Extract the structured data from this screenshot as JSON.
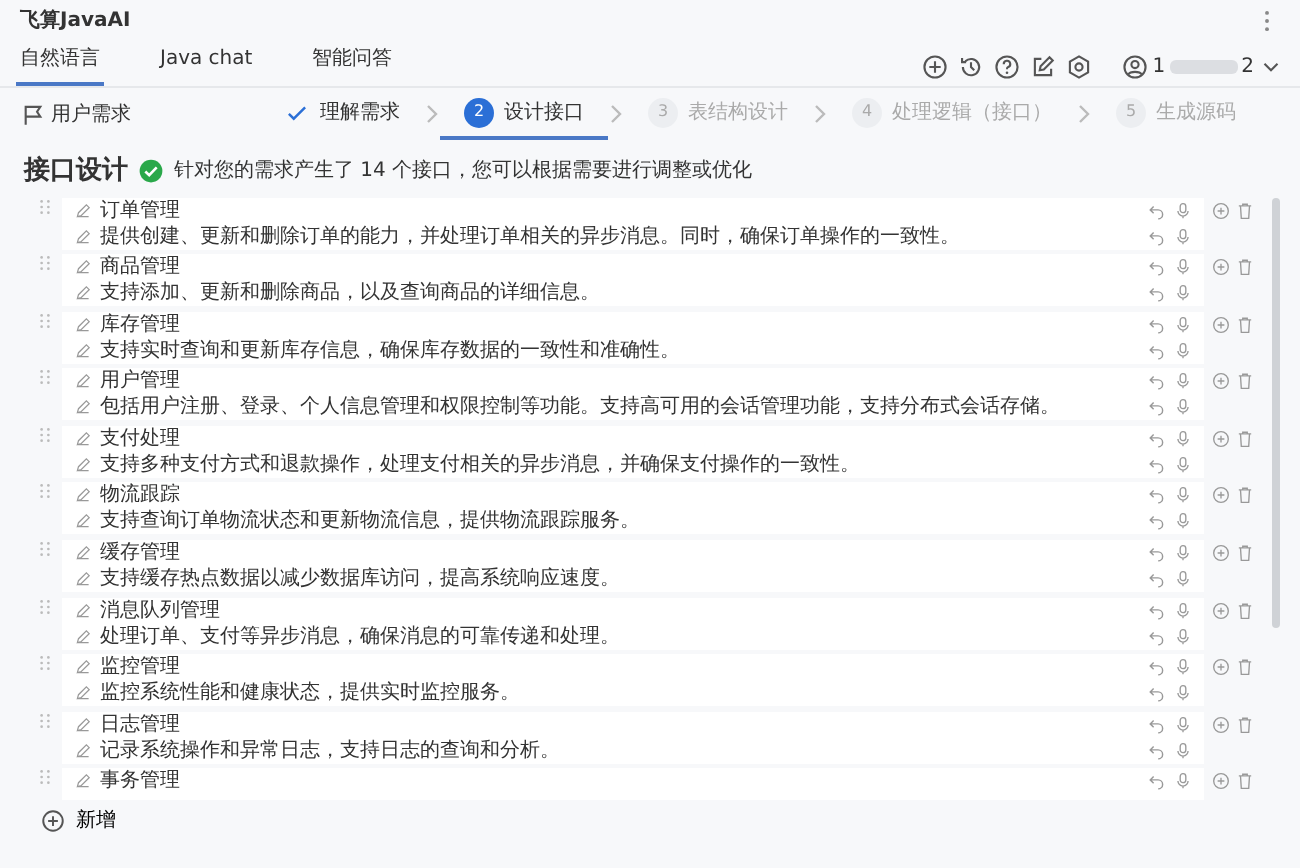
{
  "window": {
    "title": "飞算JavaAI"
  },
  "tabs": [
    {
      "label": "自然语言",
      "selected": true
    },
    {
      "label": "Java chat",
      "selected": false
    },
    {
      "label": "智能问答",
      "selected": false
    }
  ],
  "user": {
    "prefix": "1",
    "suffix": "2"
  },
  "requirement_label": "用户需求",
  "steps": [
    {
      "label": "理解需求",
      "completed": true,
      "selected": false
    },
    {
      "number": "2",
      "label": "设计接口",
      "completed": false,
      "selected": true
    },
    {
      "number": "3",
      "label": "表结构设计",
      "completed": false,
      "selected": false
    },
    {
      "number": "4",
      "label": "处理逻辑（接口）",
      "completed": false,
      "selected": false
    },
    {
      "number": "5",
      "label": "生成源码",
      "completed": false,
      "selected": false
    }
  ],
  "section": {
    "title": "接口设计",
    "message": "针对您的需求产生了 14 个接口，您可以根据需要进行调整或优化"
  },
  "interfaces": [
    {
      "title": "订单管理",
      "description": "提供创建、更新和删除订单的能力，并处理订单相关的异步消息。同时，确保订单操作的一致性。"
    },
    {
      "title": "商品管理",
      "description": "支持添加、更新和删除商品，以及查询商品的详细信息。"
    },
    {
      "title": "库存管理",
      "description": "支持实时查询和更新库存信息，确保库存数据的一致性和准确性。"
    },
    {
      "title": "用户管理",
      "description": "包括用户注册、登录、个人信息管理和权限控制等功能。支持高可用的会话管理功能，支持分布式会话存储。"
    },
    {
      "title": "支付处理",
      "description": "支持多种支付方式和退款操作，处理支付相关的异步消息，并确保支付操作的一致性。"
    },
    {
      "title": "物流跟踪",
      "description": "支持查询订单物流状态和更新物流信息，提供物流跟踪服务。"
    },
    {
      "title": "缓存管理",
      "description": "支持缓存热点数据以减少数据库访问，提高系统响应速度。"
    },
    {
      "title": "消息队列管理",
      "description": "处理订单、支付等异步消息，确保消息的可靠传递和处理。"
    },
    {
      "title": "监控管理",
      "description": "监控系统性能和健康状态，提供实时监控服务。"
    },
    {
      "title": "日志管理",
      "description": "记录系统操作和异常日志，支持日志的查询和分析。"
    },
    {
      "title": "事务管理"
    }
  ],
  "add_label": "新增"
}
